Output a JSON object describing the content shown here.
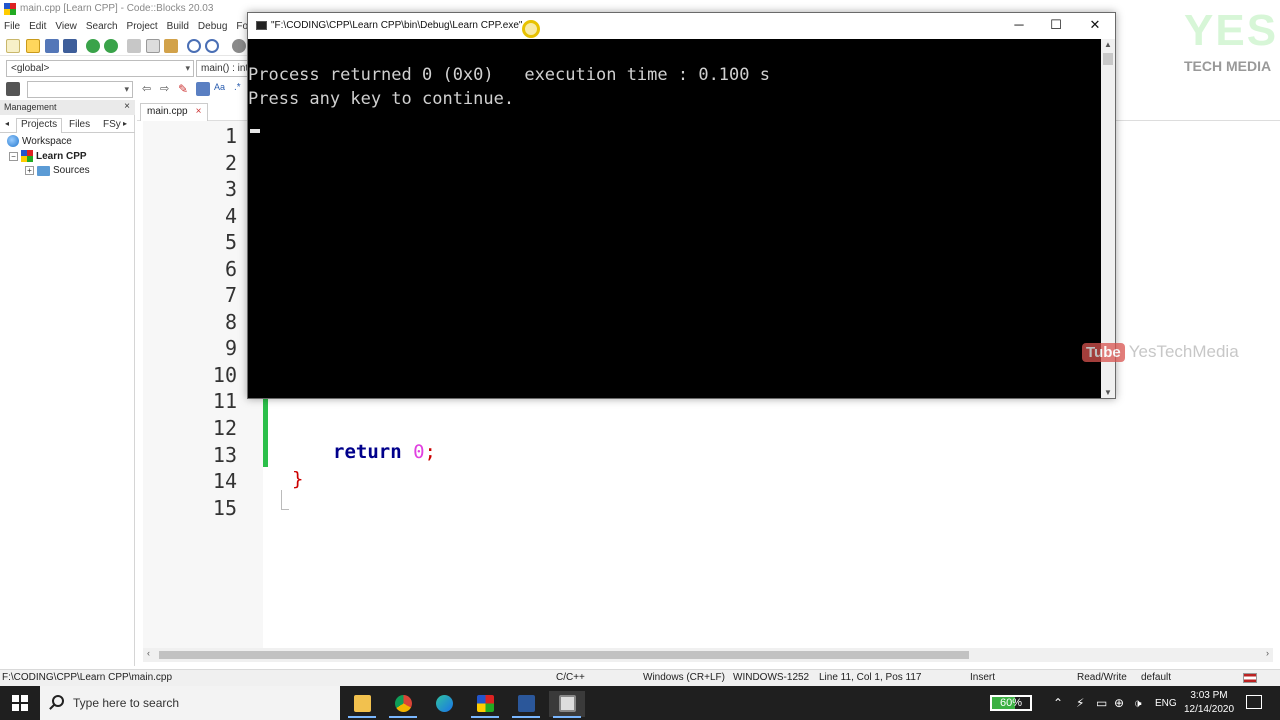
{
  "window": {
    "title": "main.cpp [Learn CPP] - Code::Blocks 20.03"
  },
  "menubar": [
    "File",
    "Edit",
    "View",
    "Search",
    "Project",
    "Build",
    "Debug",
    "Fo"
  ],
  "toolbar": {
    "scope_combo": "<global>",
    "function_combo": "main() : int"
  },
  "management": {
    "title": "Management",
    "tabs": [
      "Projects",
      "Files",
      "FSy"
    ],
    "tree": {
      "workspace": "Workspace",
      "project": "Learn CPP",
      "sources": "Sources"
    }
  },
  "editor": {
    "tab_label": "main.cpp",
    "line_numbers": [
      "1",
      "2",
      "3",
      "4",
      "5",
      "6",
      "7",
      "8",
      "9",
      "10",
      "11",
      "12",
      "13",
      "14",
      "15"
    ],
    "code": {
      "return_kw": "return",
      "return_val": "0",
      "semicolon": ";",
      "closing_brace": "}"
    }
  },
  "console": {
    "title": "\"F:\\CODING\\CPP\\Learn CPP\\bin\\Debug\\Learn CPP.exe\"",
    "line1": "Process returned 0 (0x0)   execution time : 0.100 s",
    "line2": "Press any key to continue.",
    "controls": {
      "minimize": "─",
      "maximize": "☐",
      "close": "✕"
    }
  },
  "statusbar": {
    "path": "F:\\CODING\\CPP\\Learn CPP\\main.cpp",
    "language": "C/C++",
    "line_endings": "Windows (CR+LF)",
    "encoding": "WINDOWS-1252",
    "position": "Line 11, Col 1, Pos 117",
    "mode": "Insert",
    "access": "Read/Write",
    "profile": "default"
  },
  "watermark": {
    "top": "YES",
    "bottom": "TECH MEDIA",
    "yt_logo": "Tube",
    "yt_name": "YesTechMedia"
  },
  "taskbar": {
    "search_placeholder": "Type here to search",
    "battery": "60%",
    "language": "ENG",
    "time": "3:03 PM",
    "date": "12/14/2020"
  },
  "colors": {
    "console_bg": "#000000",
    "console_text": "#d0d0d0",
    "keyword": "#00008b",
    "number": "#e040e0",
    "brace": "#cc0000",
    "change_bar": "#2bbf4a"
  }
}
